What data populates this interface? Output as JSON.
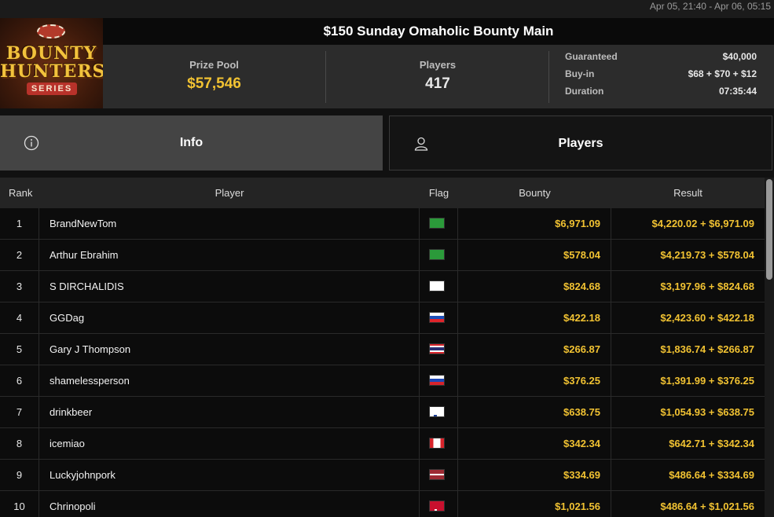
{
  "header": {
    "date_range": "Apr 05, 21:40 - Apr 06, 05:15",
    "title": "$150 Sunday Omaholic Bounty Main",
    "logo": {
      "line1": "BOUNTY",
      "line2": "HUNTERS",
      "line3": "SERIES"
    }
  },
  "stats": {
    "prize_pool_label": "Prize Pool",
    "prize_pool_value": "$57,546",
    "players_label": "Players",
    "players_value": "417",
    "guaranteed_label": "Guaranteed",
    "guaranteed_value": "$40,000",
    "buyin_label": "Buy-in",
    "buyin_value": "$68 + $70 + $12",
    "duration_label": "Duration",
    "duration_value": "07:35:44"
  },
  "tabs": {
    "info": {
      "label": "Info",
      "icon": "info-icon"
    },
    "players": {
      "label": "Players",
      "icon": "user-icon"
    }
  },
  "table": {
    "headers": {
      "rank": "Rank",
      "player": "Player",
      "flag": "Flag",
      "bounty": "Bounty",
      "result": "Result"
    },
    "rows": [
      {
        "rank": "1",
        "player": "BrandNewTom",
        "flag": "brazil",
        "bounty": "$6,971.09",
        "result": "$4,220.02 + $6,971.09"
      },
      {
        "rank": "2",
        "player": "Arthur Ebrahim",
        "flag": "brazil",
        "bounty": "$578.04",
        "result": "$4,219.73 + $578.04"
      },
      {
        "rank": "3",
        "player": "S DIRCHALIDIS",
        "flag": "cyprus",
        "bounty": "$824.68",
        "result": "$3,197.96 + $824.68"
      },
      {
        "rank": "4",
        "player": "GGDag",
        "flag": "slovenia",
        "bounty": "$422.18",
        "result": "$2,423.60 + $422.18"
      },
      {
        "rank": "5",
        "player": "Gary J Thompson",
        "flag": "thailand",
        "bounty": "$266.87",
        "result": "$1,836.74 + $266.87"
      },
      {
        "rank": "6",
        "player": "shamelessperson",
        "flag": "russia",
        "bounty": "$376.25",
        "result": "$1,391.99 + $376.25"
      },
      {
        "rank": "7",
        "player": "drinkbeer",
        "flag": "finland",
        "bounty": "$638.75",
        "result": "$1,054.93 + $638.75"
      },
      {
        "rank": "8",
        "player": "icemiao",
        "flag": "canada",
        "bounty": "$342.34",
        "result": "$642.71 + $342.34"
      },
      {
        "rank": "9",
        "player": "Luckyjohnpork",
        "flag": "latvia",
        "bounty": "$334.69",
        "result": "$486.64 + $334.69"
      },
      {
        "rank": "10",
        "player": "Chrinopoli",
        "flag": "denmark",
        "bounty": "$1,021.56",
        "result": "$486.64 + $1,021.56"
      }
    ]
  },
  "colors": {
    "accent_gold": "#f1c232",
    "background": "#111111",
    "active_tab": "#444444"
  }
}
